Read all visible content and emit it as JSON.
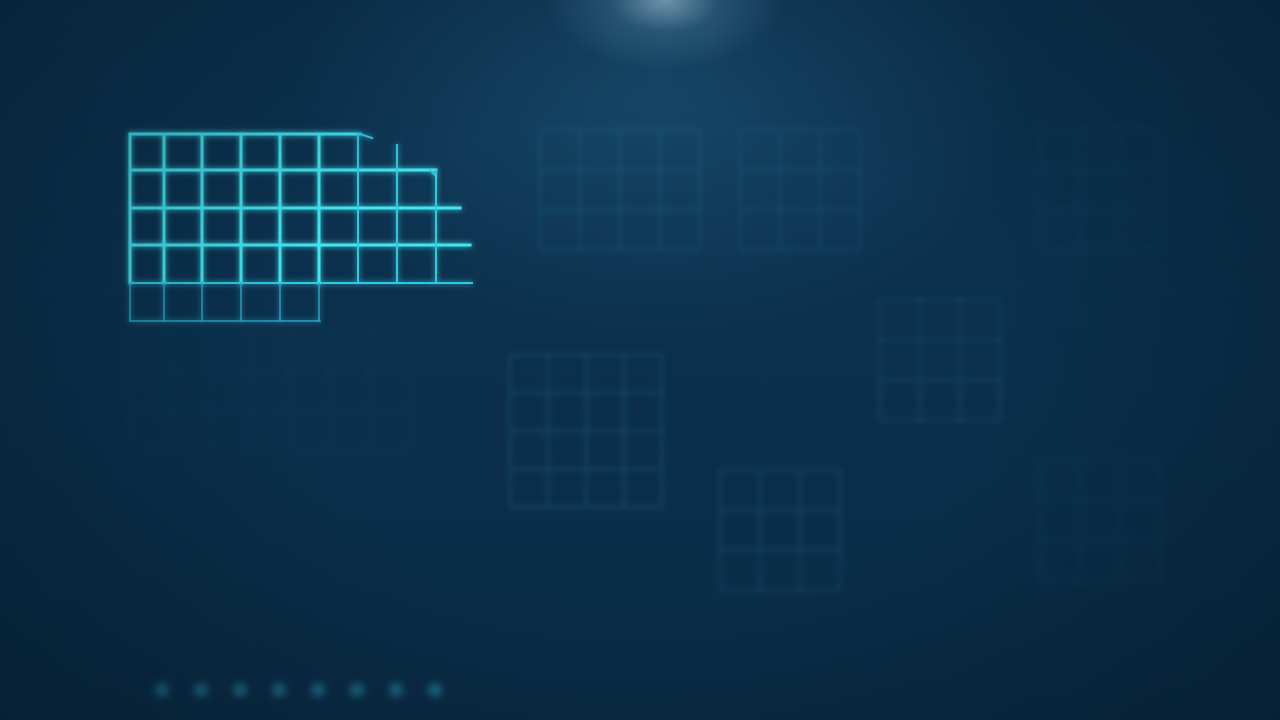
{
  "scene": {
    "description_type": "background",
    "colors": {
      "background": "#0b2f4a",
      "glow_spot": "#aad7eb",
      "grid_bright": "#3fe6f0",
      "grid_dim": "#2a7fa0"
    }
  }
}
